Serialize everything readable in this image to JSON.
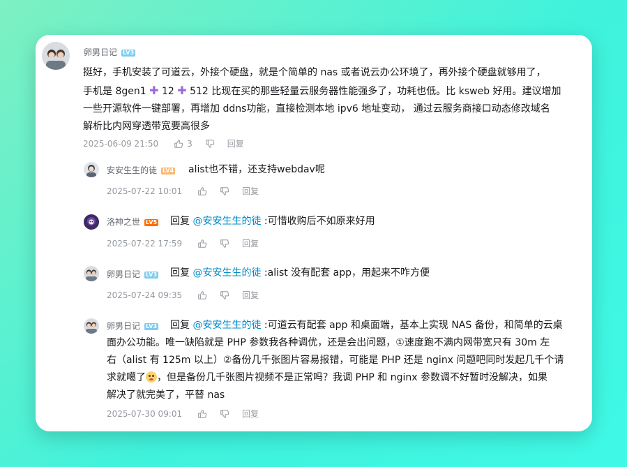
{
  "main_comment": {
    "username": "卵男日记",
    "level": "LV3",
    "lines": [
      "挺好，手机安装了可道云，外接个硬盘，就是个简单的 nas 或者说云办公环境了，再外接个硬盘就够用了，",
      "比现在买的那些轻量云服务器性能强多了，功耗也低。比 ksweb 好用。建议增加",
      "一些开源软件一键部署，再增加 ddns功能，直接检测本地 ipv6 地址变动， 通过云服务商接口动态修改域名",
      "解析比内网穿透带宽要高很多"
    ],
    "phone_prefix": "手机是 8gen1",
    "spec_a": "12",
    "spec_b": "512",
    "time": "2025-06-09 21:50",
    "likes": "3",
    "reply_label": "回复"
  },
  "replies": [
    {
      "username": "安安生生的徒",
      "level": "LV4",
      "reply_prefix": "",
      "mention": "",
      "content": "alist也不错，还支持webdav呢",
      "time": "2025-07-22 10:01",
      "reply_label": "回复"
    },
    {
      "username": "洛神之世",
      "level": "LV5",
      "reply_prefix": "回复",
      "mention": "@安安生生的徒",
      "content": ":可惜收购后不如原来好用",
      "time": "2025-07-22 17:59",
      "reply_label": "回复"
    },
    {
      "username": "卵男日记",
      "level": "LV3",
      "reply_prefix": "回复",
      "mention": "@安安生生的徒",
      "content": ":alist 没有配套 app，用起来不咋方便",
      "time": "2025-07-24 09:35",
      "reply_label": "回复"
    },
    {
      "username": "卵男日记",
      "level": "LV3",
      "reply_prefix": "回复",
      "mention": "@安安生生的徒",
      "content": ":可道云有配套 app 和桌面端，基本上实现 NAS 备份，和简单的云桌",
      "content_lines": [
        "面办公功能。唯一缺陷就是 PHP 参数我各种调优，还是会出问题，①速度跑不满内网带宽只有 30m 左",
        "右（alist 有 125m 以上）②备份几千张图片容易报错，可能是 PHP 还是 nginx 问题吧同时发起几千个请",
        "，但是备份几千张图片视频不是正常吗？我调 PHP 和 nginx 参数调不好暂时没解决，如果",
        "解决了就完美了，平替 nas"
      ],
      "emoji_prefix": "求就噶了",
      "time": "2025-07-30 09:01",
      "reply_label": "回复"
    }
  ]
}
